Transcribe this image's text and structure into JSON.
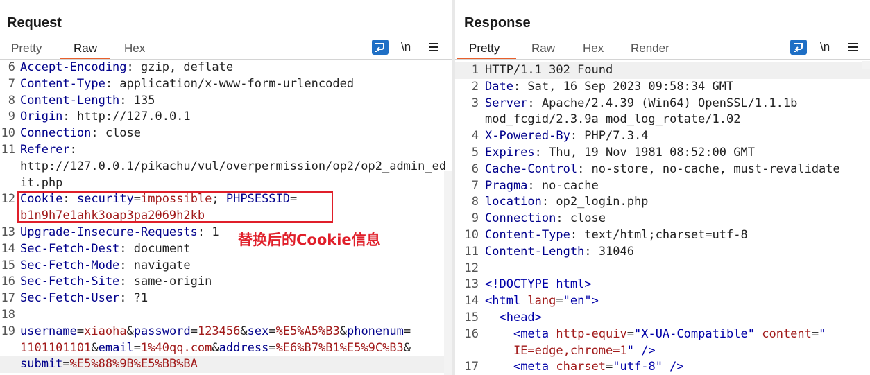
{
  "request": {
    "title": "Request",
    "tabs": [
      "Pretty",
      "Raw",
      "Hex"
    ],
    "active_tab": "Raw",
    "newline_toggle": "\\n",
    "lines": [
      {
        "n": "6",
        "parts": [
          [
            "k",
            "Accept-Encoding"
          ],
          [
            "v",
            ": gzip, deflate"
          ]
        ]
      },
      {
        "n": "7",
        "parts": [
          [
            "k",
            "Content-Type"
          ],
          [
            "v",
            ": application/x-www-form-urlencoded"
          ]
        ]
      },
      {
        "n": "8",
        "parts": [
          [
            "k",
            "Content-Length"
          ],
          [
            "v",
            ": 135"
          ]
        ]
      },
      {
        "n": "9",
        "parts": [
          [
            "k",
            "Origin"
          ],
          [
            "v",
            ": http://127.0.0.1"
          ]
        ]
      },
      {
        "n": "10",
        "parts": [
          [
            "k",
            "Connection"
          ],
          [
            "v",
            ": close"
          ]
        ]
      },
      {
        "n": "11",
        "parts": [
          [
            "k",
            "Referer"
          ],
          [
            "v",
            ":"
          ]
        ]
      },
      {
        "n": "",
        "parts": [
          [
            "v",
            "http://127.0.0.1/pikachu/vul/overpermission/op2/op2_admin_ed"
          ]
        ]
      },
      {
        "n": "",
        "parts": [
          [
            "v",
            "it.php"
          ]
        ]
      },
      {
        "n": "12",
        "parts": [
          [
            "k",
            "Cookie"
          ],
          [
            "v",
            ": "
          ],
          [
            "k",
            "security"
          ],
          [
            "v",
            "="
          ],
          [
            "val",
            "impossible"
          ],
          [
            "v",
            "; "
          ],
          [
            "k",
            "PHPSESSID"
          ],
          [
            "v",
            "="
          ]
        ]
      },
      {
        "n": "",
        "parts": [
          [
            "val",
            "b1n9h7e1ahk3oap3pa2069h2kb"
          ]
        ]
      },
      {
        "n": "13",
        "parts": [
          [
            "k",
            "Upgrade-Insecure-Requests"
          ],
          [
            "v",
            ": 1"
          ]
        ]
      },
      {
        "n": "14",
        "parts": [
          [
            "k",
            "Sec-Fetch-Dest"
          ],
          [
            "v",
            ": document"
          ]
        ]
      },
      {
        "n": "15",
        "parts": [
          [
            "k",
            "Sec-Fetch-Mode"
          ],
          [
            "v",
            ": navigate"
          ]
        ]
      },
      {
        "n": "16",
        "parts": [
          [
            "k",
            "Sec-Fetch-Site"
          ],
          [
            "v",
            ": same-origin"
          ]
        ]
      },
      {
        "n": "17",
        "parts": [
          [
            "k",
            "Sec-Fetch-User"
          ],
          [
            "v",
            ": ?1"
          ]
        ]
      },
      {
        "n": "18",
        "parts": []
      },
      {
        "n": "19",
        "parts": [
          [
            "k",
            "username"
          ],
          [
            "v",
            "="
          ],
          [
            "val",
            "xiaoha"
          ],
          [
            "v",
            "&"
          ],
          [
            "k",
            "password"
          ],
          [
            "v",
            "="
          ],
          [
            "val",
            "123456"
          ],
          [
            "v",
            "&"
          ],
          [
            "k",
            "sex"
          ],
          [
            "v",
            "="
          ],
          [
            "val",
            "%E5%A5%B3"
          ],
          [
            "v",
            "&"
          ],
          [
            "k",
            "phonenum"
          ],
          [
            "v",
            "="
          ]
        ]
      },
      {
        "n": "",
        "parts": [
          [
            "val",
            "1101101101"
          ],
          [
            "v",
            "&"
          ],
          [
            "k",
            "email"
          ],
          [
            "v",
            "="
          ],
          [
            "val",
            "1%40qq.com"
          ],
          [
            "v",
            "&"
          ],
          [
            "k",
            "address"
          ],
          [
            "v",
            "="
          ],
          [
            "val",
            "%E6%B7%B1%E5%9C%B3"
          ],
          [
            "v",
            "&"
          ]
        ]
      },
      {
        "n": "",
        "parts": [
          [
            "k",
            "submit"
          ],
          [
            "v",
            "="
          ],
          [
            "val",
            "%E5%88%9B%E5%BB%BA"
          ]
        ]
      }
    ],
    "annotation": "替换后的Cookie信息"
  },
  "response": {
    "title": "Response",
    "tabs": [
      "Pretty",
      "Raw",
      "Hex",
      "Render"
    ],
    "active_tab": "Pretty",
    "newline_toggle": "\\n",
    "lines": [
      {
        "n": "1",
        "parts": [
          [
            "v",
            "HTTP/1.1 302 Found"
          ]
        ]
      },
      {
        "n": "2",
        "parts": [
          [
            "k",
            "Date"
          ],
          [
            "v",
            ": Sat, 16 Sep 2023 09:58:34 GMT"
          ]
        ]
      },
      {
        "n": "3",
        "parts": [
          [
            "k",
            "Server"
          ],
          [
            "v",
            ": Apache/2.4.39 (Win64) OpenSSL/1.1.1b"
          ]
        ]
      },
      {
        "n": "",
        "parts": [
          [
            "v",
            "mod_fcgid/2.3.9a mod_log_rotate/1.02"
          ]
        ]
      },
      {
        "n": "4",
        "parts": [
          [
            "k",
            "X-Powered-By"
          ],
          [
            "v",
            ": PHP/7.3.4"
          ]
        ]
      },
      {
        "n": "5",
        "parts": [
          [
            "k",
            "Expires"
          ],
          [
            "v",
            ": Thu, 19 Nov 1981 08:52:00 GMT"
          ]
        ]
      },
      {
        "n": "6",
        "parts": [
          [
            "k",
            "Cache-Control"
          ],
          [
            "v",
            ": no-store, no-cache, must-revalidate"
          ]
        ]
      },
      {
        "n": "7",
        "parts": [
          [
            "k",
            "Pragma"
          ],
          [
            "v",
            ": no-cache"
          ]
        ]
      },
      {
        "n": "8",
        "parts": [
          [
            "k",
            "location"
          ],
          [
            "v",
            ": op2_login.php"
          ]
        ]
      },
      {
        "n": "9",
        "parts": [
          [
            "k",
            "Connection"
          ],
          [
            "v",
            ": close"
          ]
        ]
      },
      {
        "n": "10",
        "parts": [
          [
            "k",
            "Content-Type"
          ],
          [
            "v",
            ": text/html;charset=utf-8"
          ]
        ]
      },
      {
        "n": "11",
        "parts": [
          [
            "k",
            "Content-Length"
          ],
          [
            "v",
            ": 31046"
          ]
        ]
      },
      {
        "n": "12",
        "parts": []
      },
      {
        "n": "13",
        "parts": [
          [
            "tag",
            "<!DOCTYPE html>"
          ]
        ]
      },
      {
        "n": "14",
        "parts": [
          [
            "tag",
            "<html "
          ],
          [
            "attr",
            "lang"
          ],
          [
            "v",
            "="
          ],
          [
            "str",
            "\"en\""
          ],
          [
            "tag",
            ">"
          ]
        ]
      },
      {
        "n": "15",
        "parts": [
          [
            "v",
            "  "
          ],
          [
            "tag",
            "<head>"
          ]
        ]
      },
      {
        "n": "16",
        "parts": [
          [
            "v",
            "    "
          ],
          [
            "tag",
            "<meta "
          ],
          [
            "attr",
            "http-equiv"
          ],
          [
            "v",
            "="
          ],
          [
            "str",
            "\"X-UA-Compatible\""
          ],
          [
            "v",
            " "
          ],
          [
            "attr",
            "content"
          ],
          [
            "v",
            "="
          ],
          [
            "str",
            "\""
          ]
        ]
      },
      {
        "n": "",
        "parts": [
          [
            "val",
            "    IE=edge,chrome=1"
          ],
          [
            "str",
            "\""
          ],
          [
            "tag",
            " />"
          ]
        ]
      },
      {
        "n": "17",
        "parts": [
          [
            "v",
            "    "
          ],
          [
            "tag",
            "<meta "
          ],
          [
            "attr",
            "charset"
          ],
          [
            "v",
            "="
          ],
          [
            "str",
            "\"utf-8\""
          ],
          [
            "tag",
            " />"
          ]
        ]
      }
    ]
  }
}
